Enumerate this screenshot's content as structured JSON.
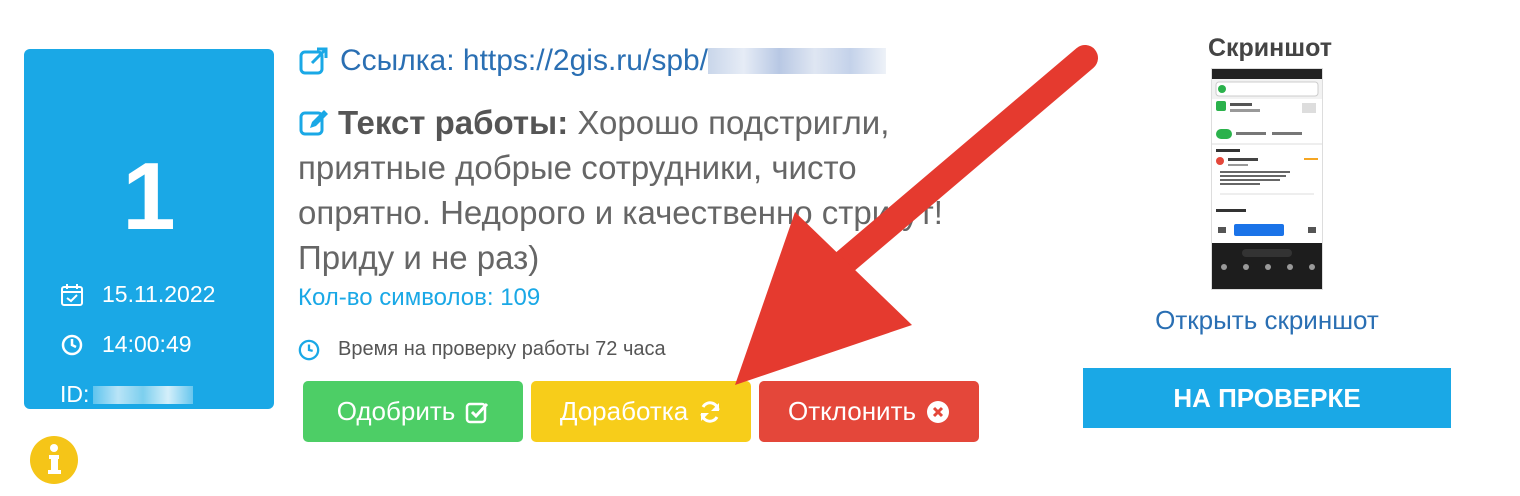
{
  "card": {
    "number": "1",
    "date": "15.11.2022",
    "time": "14:00:49",
    "id_label": "ID:"
  },
  "task": {
    "link_label": "Ссылка:",
    "link_url": "https://2gis.ru/spb/",
    "text_label": "Текст работы:",
    "text_body": "Хорошо подстригли, приятные добрые сотрудники, чисто опрятно. Недорого и качественно стригут! Приду и не раз)",
    "char_count": "Кол-во символов: 109",
    "check_time": "Время на проверку работы 72 часа"
  },
  "actions": {
    "approve": "Одобрить",
    "rework": "Доработка",
    "reject": "Отклонить"
  },
  "screenshot": {
    "title": "Скриншот",
    "open_label": "Открыть скриншот",
    "status": "НА ПРОВЕРКЕ"
  },
  "colors": {
    "card_bg": "#1aa8e6",
    "approve": "#4dce66",
    "rework": "#f7cd1a",
    "reject": "#e4473a",
    "arrow": "#e53a2f",
    "link": "#2a6fb3"
  }
}
